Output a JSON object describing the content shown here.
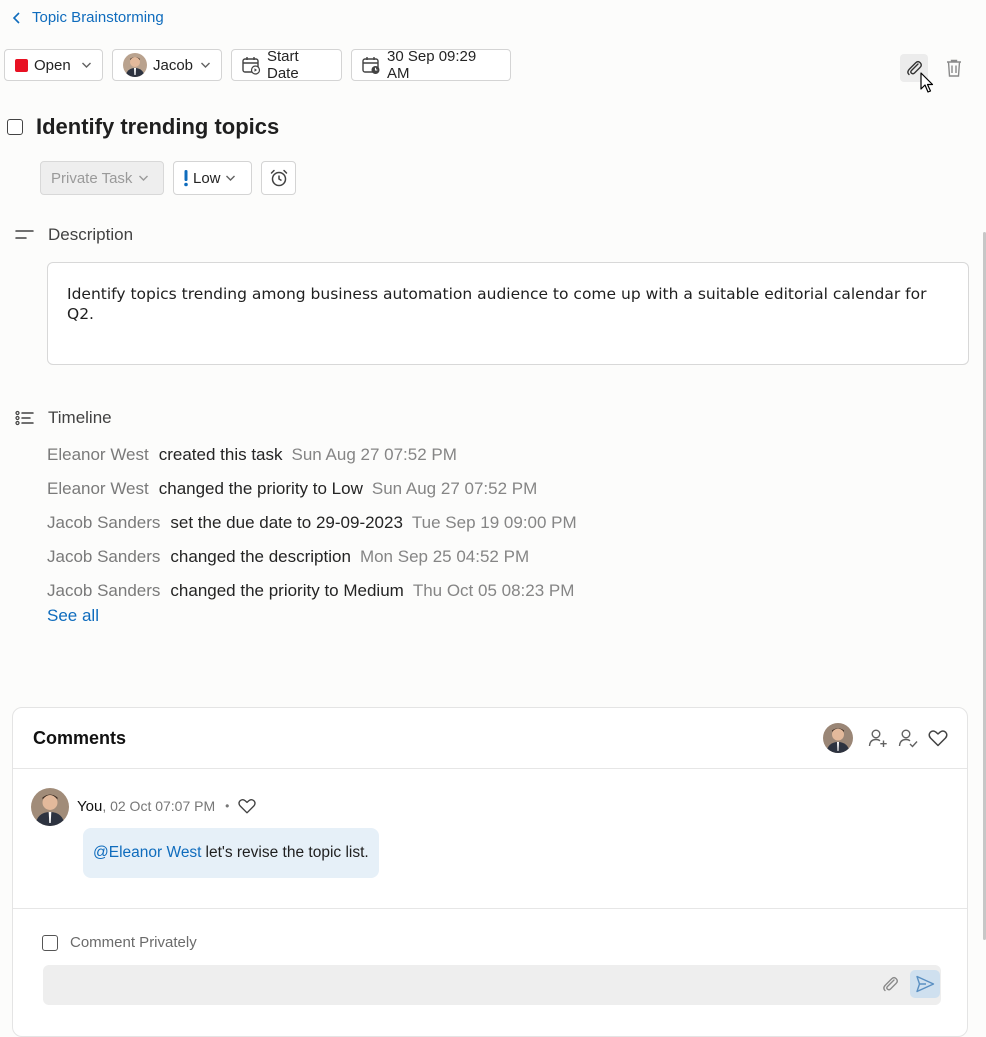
{
  "breadcrumb": {
    "back_label": "Topic Brainstorming"
  },
  "toolbar": {
    "status_label": "Open",
    "status_color": "#e81123",
    "assignee_label": "Jacob",
    "start_date_label": "Start Date",
    "due_date_label": "30 Sep 09:29 AM",
    "icons": [
      "attachment-icon",
      "delete-icon"
    ]
  },
  "task": {
    "title": "Identify trending topics",
    "visibility_label": "Private Task",
    "priority_label": "Low",
    "priority_color": "#0f6cbd"
  },
  "description": {
    "header": "Description",
    "text": "Identify topics trending among business automation audience to come up with a suitable editorial calendar for Q2."
  },
  "timeline": {
    "header": "Timeline",
    "entries": [
      {
        "user": "Eleanor West",
        "action": "created this task",
        "time": "Sun Aug 27 07:52 PM"
      },
      {
        "user": "Eleanor West",
        "action": "changed the priority to Low",
        "time": "Sun Aug 27 07:52 PM"
      },
      {
        "user": "Jacob Sanders",
        "action": "set the due date to 29-09-2023",
        "time": "Tue Sep 19 09:00 PM"
      },
      {
        "user": "Jacob Sanders",
        "action": "changed the description",
        "time": "Mon Sep 25 04:52 PM"
      },
      {
        "user": "Jacob Sanders",
        "action": "changed the priority to Medium",
        "time": "Thu Oct 05 08:23 PM"
      }
    ],
    "see_all_label": "See all"
  },
  "comments": {
    "header": "Comments",
    "items": [
      {
        "author": "You",
        "time": ", 02 Oct 07:07 PM",
        "separator": "•",
        "mention": "@Eleanor West",
        "text": "let's revise the topic list."
      }
    ],
    "private_label": "Comment Privately",
    "input_placeholder": ""
  }
}
